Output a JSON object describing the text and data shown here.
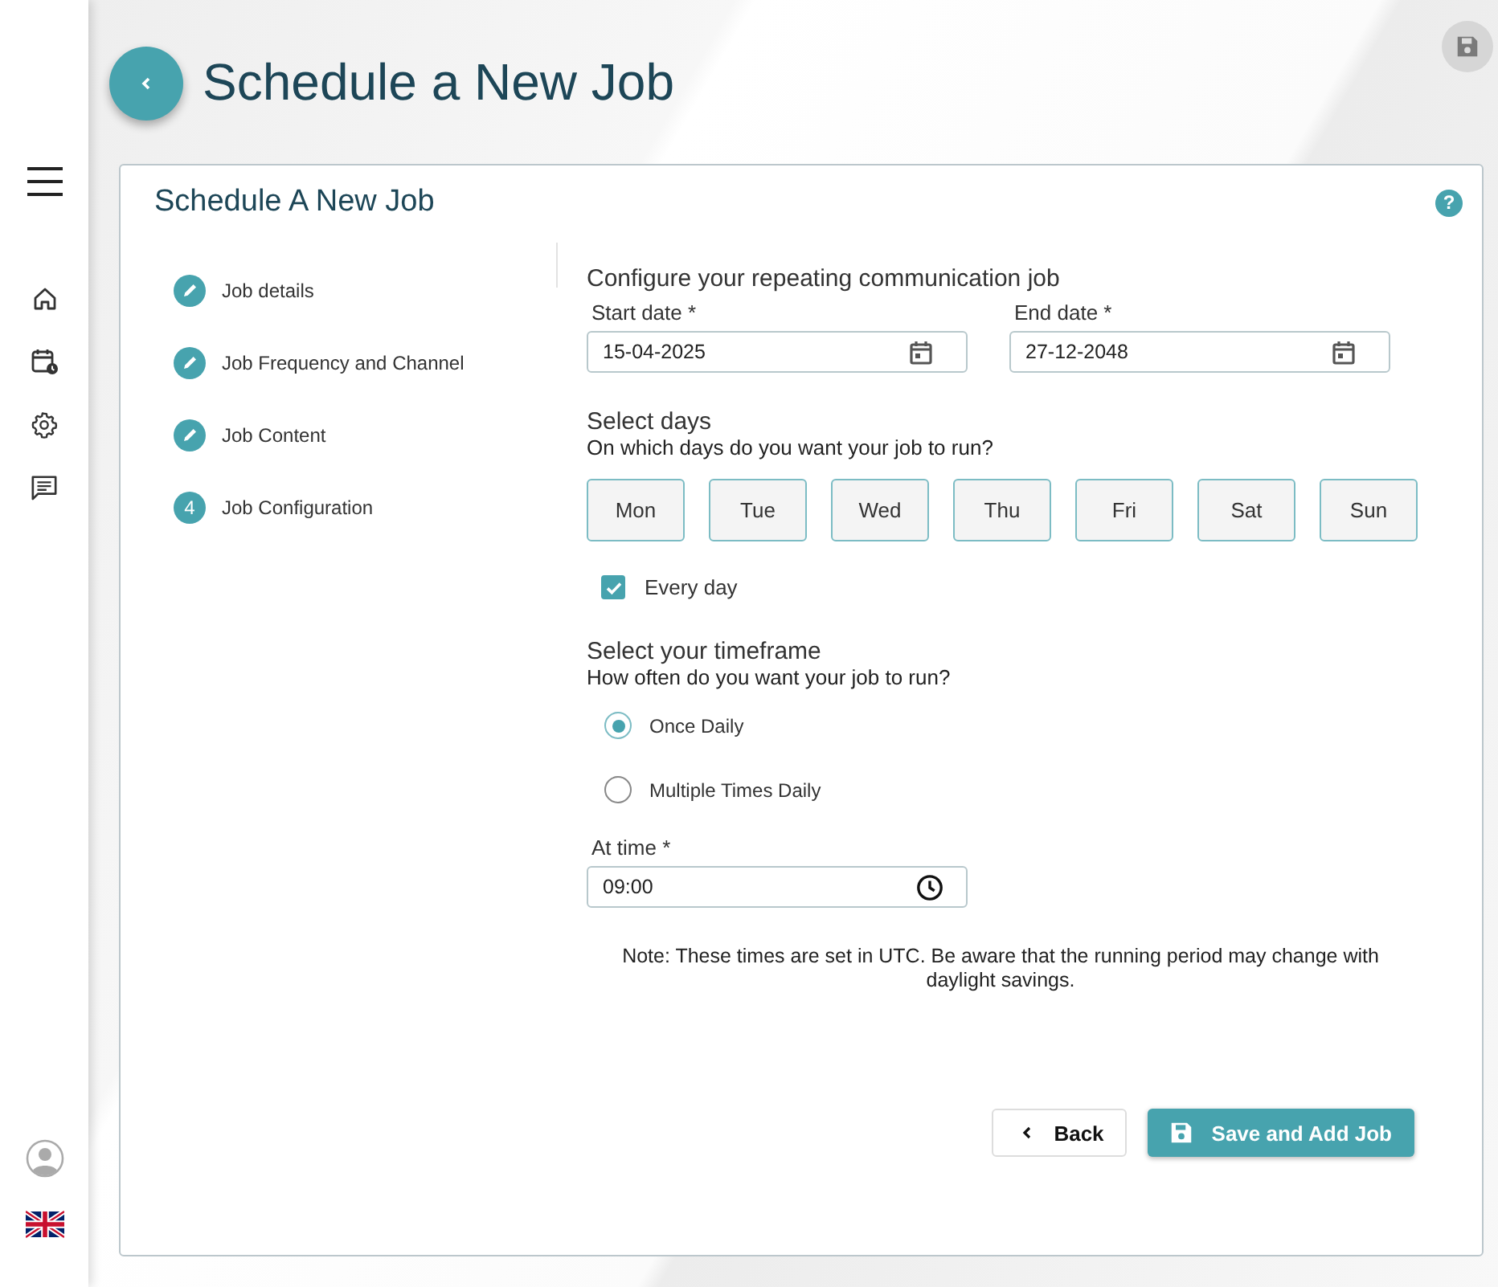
{
  "page_title": "Schedule a New Job",
  "card": {
    "title": "Schedule A New Job",
    "help": "?"
  },
  "steps": [
    {
      "kind": "done",
      "label": "Job details"
    },
    {
      "kind": "done",
      "label": "Job Frequency and Channel"
    },
    {
      "kind": "done",
      "label": "Job Content"
    },
    {
      "kind": "current",
      "number": "4",
      "label": "Job Configuration"
    }
  ],
  "form": {
    "heading": "Configure your repeating communication job",
    "dates": [
      {
        "label": "Start date *",
        "value": "15-04-2025"
      },
      {
        "label": "End date *",
        "value": "27-12-2048"
      }
    ],
    "days_heading": "Select days",
    "days_question": "On which days do you want your job to run?",
    "days": [
      {
        "label": "Mon",
        "selected": false
      },
      {
        "label": "Tue",
        "selected": false
      },
      {
        "label": "Wed",
        "selected": false
      },
      {
        "label": "Thu",
        "selected": false
      },
      {
        "label": "Fri",
        "selected": false
      },
      {
        "label": "Sat",
        "selected": false
      },
      {
        "label": "Sun",
        "selected": false
      }
    ],
    "every_day": {
      "label": "Every day",
      "checked": true
    },
    "timeframe_heading": "Select your timeframe",
    "timeframe_question": "How often do you want your job to run?",
    "timeframes": [
      {
        "label": "Once Daily",
        "selected": true
      },
      {
        "label": "Multiple Times Daily",
        "selected": false
      }
    ],
    "time": {
      "label": "At time *",
      "value": "09:00"
    },
    "note": "Note: These times are set in UTC. Be aware that the running period may change with daylight savings."
  },
  "buttons": {
    "back": "Back",
    "save": "Save and Add Job"
  }
}
